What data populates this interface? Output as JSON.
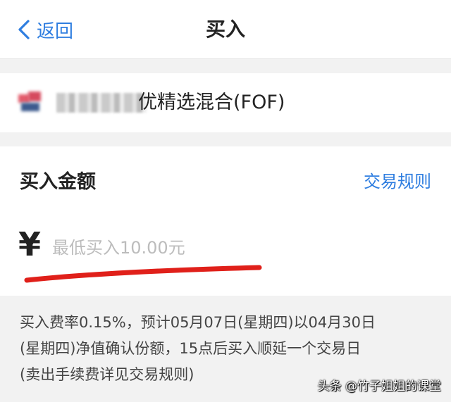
{
  "header": {
    "back_label": "返回",
    "title": "买入"
  },
  "fund": {
    "name_visible": "优精选混合(FOF)"
  },
  "amount": {
    "title": "买入金额",
    "rule_link": "交易规则",
    "currency_symbol": "¥",
    "placeholder": "最低买入10.00元",
    "value": ""
  },
  "fee_note": {
    "line1": "买入费率0.15%，预计05月07日(星期四)以04月30日",
    "line2": "(星期四)净值确认份额，15点后买入顺延一个交易日",
    "line3": "(卖出手续费详见交易规则)"
  },
  "watermark": "头条 @竹子姐姐的课堂",
  "colors": {
    "accent": "#2f7ee0",
    "annotation": "#e0201a",
    "background": "#f2f2f2"
  }
}
